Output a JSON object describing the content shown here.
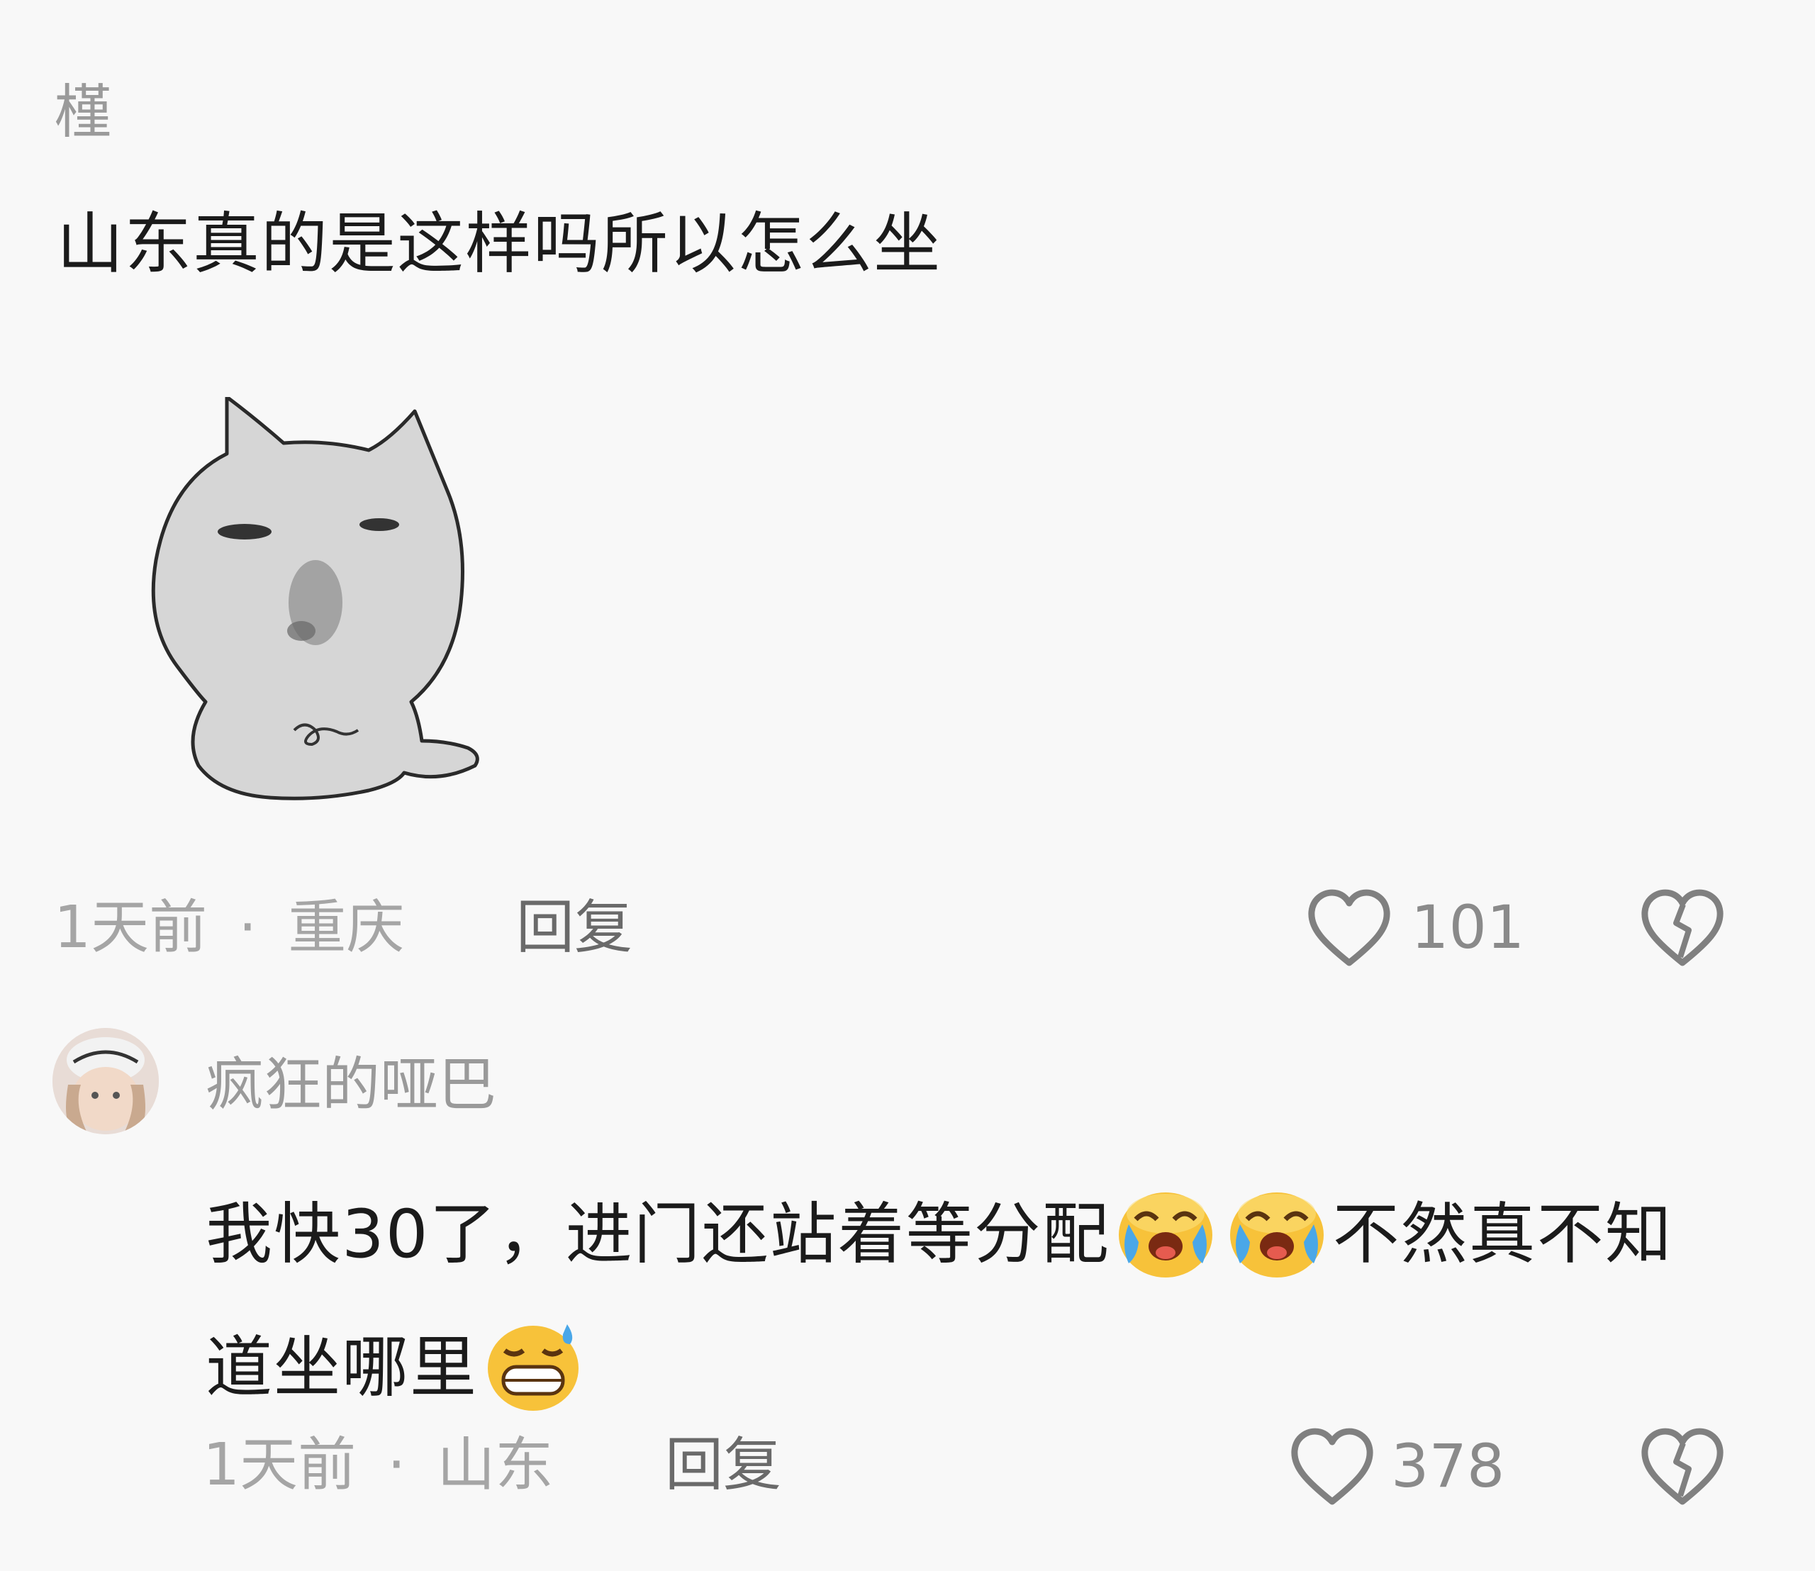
{
  "comments": [
    {
      "username": "槿",
      "text": "山东真的是这样吗所以怎么坐",
      "sticker": "cat-face-sticker",
      "time": "1天前",
      "separator": "·",
      "location": "重庆",
      "reply_label": "回复",
      "likes": "101"
    },
    {
      "username": "疯狂的哑巴",
      "avatar": "user-avatar-photo",
      "text_parts": [
        "我快30了，进门还站着等分配",
        "不然真不知道坐哪里"
      ],
      "emojis": [
        "crying-laugh-emoji",
        "crying-laugh-emoji",
        "nervous-grin-emoji"
      ],
      "time": "1天前",
      "separator": "·",
      "location": "山东",
      "reply_label": "回复",
      "likes": "378"
    }
  ],
  "icons": {
    "like": "heart-outline-icon",
    "dislike": "broken-heart-icon"
  },
  "colors": {
    "background": "#f8f8f8",
    "text": "#1b1b1b",
    "meta": "#a5a5a5",
    "icon": "#808080"
  }
}
